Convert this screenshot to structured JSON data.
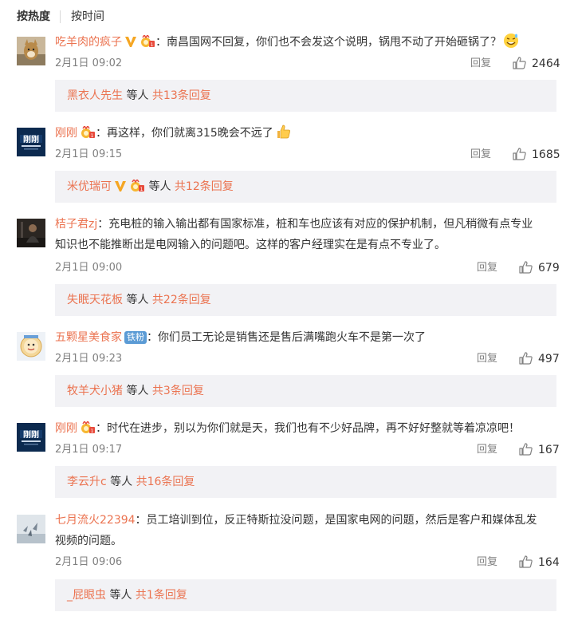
{
  "sort": {
    "hot_label": "按热度",
    "time_label": "按时间"
  },
  "colors": {
    "username": "#eb7350",
    "meta": "#808080",
    "sub_bg": "#f2f2f5",
    "tiefen_bg": "#5b9bd5"
  },
  "comments": [
    {
      "username": "吃羊肉的疯子",
      "badges": [
        "vip-v-icon",
        "fan-badge-icon"
      ],
      "text": "：南昌国网不回复，你们也不会发这个说明，锅甩不动了开始砸锅了？",
      "emoji": "sweat-smile-emoji",
      "time": "2月1日 09:02",
      "reply_label": "回复",
      "likes": "2464",
      "sub_user": "黑衣人先生",
      "sub_mid": " 等人 ",
      "sub_count": "共13条回复"
    },
    {
      "username": "刚刚",
      "badges": [
        "fan-badge-icon"
      ],
      "text": "：再这样，你们就离315晚会不远了",
      "emoji": "thumbs-up-emoji",
      "time": "2月1日 09:15",
      "reply_label": "回复",
      "likes": "1685",
      "sub_user": "米优瑞可",
      "sub_mid": " 等人 ",
      "sub_count": "共12条回复"
    },
    {
      "username": "桔子君zj",
      "text_line1": "：充电桩的输入输出都有国家标准，桩和车也应该有对应的保护机制，但凡稍微有点专业",
      "text_line2": "知识也不能推断出是电网输入的问题吧。这样的客户经理实在是有点不专业了。",
      "time": "2月1日 09:00",
      "reply_label": "回复",
      "likes": "679",
      "sub_user": "失眠天花板",
      "sub_mid": " 等人 ",
      "sub_count": "共22条回复"
    },
    {
      "username": "五颗星美食家",
      "tiefen": "铁粉",
      "text": "：你们员工无论是销售还是售后满嘴跑火车不是第一次了",
      "time": "2月1日 09:23",
      "reply_label": "回复",
      "likes": "497",
      "sub_user": "牧羊犬小猪",
      "sub_mid": " 等人 ",
      "sub_count": "共3条回复"
    },
    {
      "username": "刚刚",
      "badges": [
        "fan-badge-icon"
      ],
      "text": "：时代在进步，别以为你们就是天，我们也有不少好品牌，再不好好整就等着凉凉吧！",
      "time": "2月1日 09:17",
      "reply_label": "回复",
      "likes": "167",
      "sub_user": "李云升c",
      "sub_mid": " 等人 ",
      "sub_count": "共16条回复"
    },
    {
      "username": "七月流火22394",
      "text_line1": "：员工培训到位，反正特斯拉没问题，是国家电网的问题，然后是客户和媒体乱发",
      "text_line2": "视频的问题。",
      "time": "2月1日 09:06",
      "reply_label": "回复",
      "likes": "164",
      "sub_user": "_屁眼虫",
      "sub_mid": " 等人 ",
      "sub_count": "共1条回复"
    }
  ]
}
